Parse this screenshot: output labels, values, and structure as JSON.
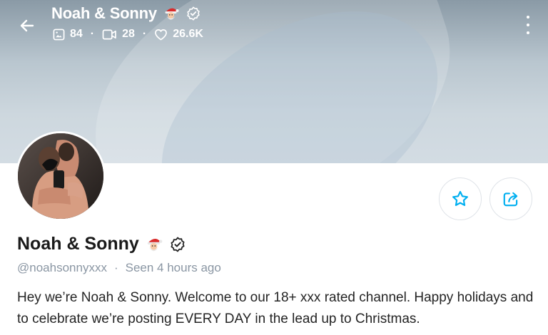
{
  "header": {
    "title": "Noah & Sonny",
    "stats": {
      "photos": "84",
      "videos": "28",
      "likes": "26.6K"
    }
  },
  "profile": {
    "name": "Noah & Sonny",
    "username": "@noahsonnyxxx",
    "last_seen": "Seen 4 hours ago",
    "bio": "Hey we’re Noah & Sonny. Welcome to our 18+ xxx rated channel. Happy holidays and to celebrate we’re posting EVERY DAY in the lead up to Christmas."
  },
  "icons": {
    "back": "arrow-left-icon",
    "photos": "image-icon",
    "videos": "video-icon",
    "likes": "heart-icon",
    "more": "more-vertical-icon",
    "favorite": "star-icon",
    "share": "share-icon",
    "verified": "verified-badge-icon",
    "emoji": "santa-emoji-icon"
  },
  "colors": {
    "accent": "#00aff0",
    "muted_text": "#8a96a3",
    "body_text": "#242424"
  }
}
